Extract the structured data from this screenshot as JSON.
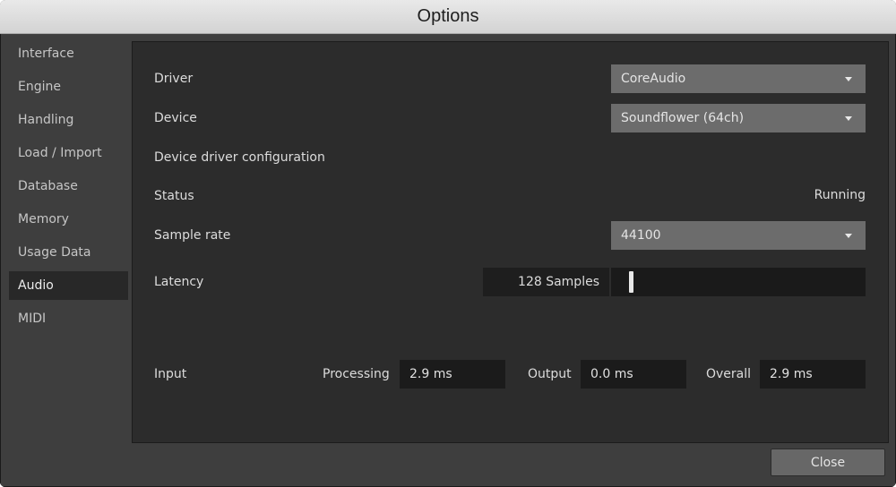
{
  "window": {
    "title": "Options"
  },
  "sidebar": {
    "items": [
      {
        "label": "Interface",
        "active": false
      },
      {
        "label": "Engine",
        "active": false
      },
      {
        "label": "Handling",
        "active": false
      },
      {
        "label": "Load / Import",
        "active": false
      },
      {
        "label": "Database",
        "active": false
      },
      {
        "label": "Memory",
        "active": false
      },
      {
        "label": "Usage Data",
        "active": false
      },
      {
        "label": "Audio",
        "active": true
      },
      {
        "label": "MIDI",
        "active": false
      }
    ]
  },
  "audio": {
    "driver": {
      "label": "Driver",
      "value": "CoreAudio"
    },
    "device": {
      "label": "Device",
      "value": "Soundflower (64ch)"
    },
    "device_config": {
      "label": "Device driver configuration"
    },
    "status": {
      "label": "Status",
      "value": "Running"
    },
    "sample_rate": {
      "label": "Sample rate",
      "value": "44100"
    },
    "latency": {
      "label": "Latency",
      "value": "128 Samples",
      "slider_fraction": 0.07
    },
    "input": {
      "label": "Input",
      "processing_label": "Processing",
      "processing_value": "2.9 ms",
      "output_label": "Output",
      "output_value": "0.0 ms",
      "overall_label": "Overall",
      "overall_value": "2.9 ms"
    }
  },
  "footer": {
    "close_label": "Close"
  }
}
